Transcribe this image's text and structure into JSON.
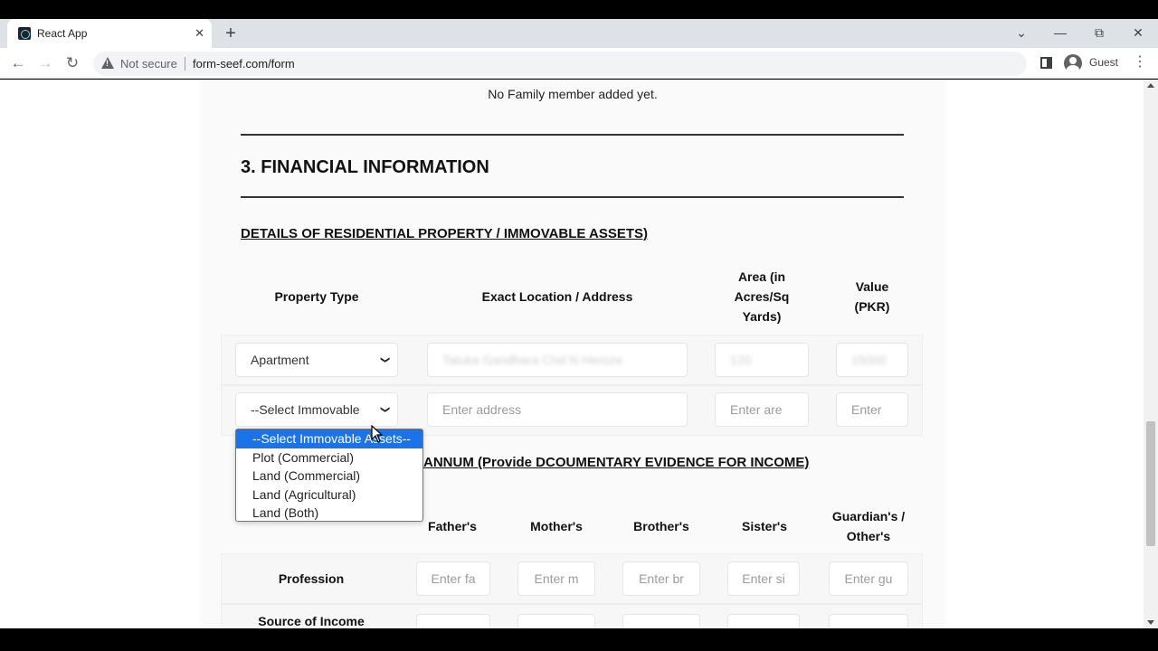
{
  "browser": {
    "tab_title": "React App",
    "tab_close": "✕",
    "new_tab": "+",
    "not_secure": "Not secure",
    "url": "form-seef.com/form",
    "profile_label": "Guest",
    "win_chevron": "⌄",
    "win_minimize": "—",
    "win_restore": "⧉",
    "win_close": "✕",
    "back": "←",
    "forward": "→",
    "reload": "↻",
    "kebab": "⋮"
  },
  "form": {
    "family_empty_msg": "No Family member added yet.",
    "section_title": "3. FINANCIAL INFORMATION",
    "property_subtitle": "DETAILS OF RESIDENTIAL PROPERTY / IMMOVABLE ASSETS)",
    "property_table": {
      "headers": {
        "type": "Property Type",
        "location": "Exact Location / Address",
        "area": "Area (in Acres/Sq Yards)",
        "value": "Value (PKR)"
      },
      "row1": {
        "type": "Apartment",
        "location": "Taluka Gandhara Chd N Heroze",
        "area": "120",
        "value": "15000"
      },
      "row2": {
        "type": "--Select Immovable",
        "location_placeholder": "Enter address",
        "area_placeholder": "Enter are",
        "value_placeholder": "Enter"
      }
    },
    "dropdown_options": [
      "--Select Immovable Assets--",
      "Plot (Commercial)",
      "Land (Commercial)",
      "Land (Agricultural)",
      "Land (Both)"
    ],
    "income_subtitle": "ANNUM (Provide DCOUMENTARY EVIDENCE FOR INCOME)",
    "income_table": {
      "headers": {
        "father": "Father's",
        "mother": "Mother's",
        "brother": "Brother's",
        "sister": "Sister's",
        "guardian": "Guardian's / Other's"
      },
      "rows": {
        "profession": "Profession",
        "source": "Source of Income"
      },
      "placeholders": {
        "father": "Enter fa",
        "mother": "Enter m",
        "brother": "Enter br",
        "sister": "Enter si",
        "guardian": "Enter gu"
      }
    }
  }
}
